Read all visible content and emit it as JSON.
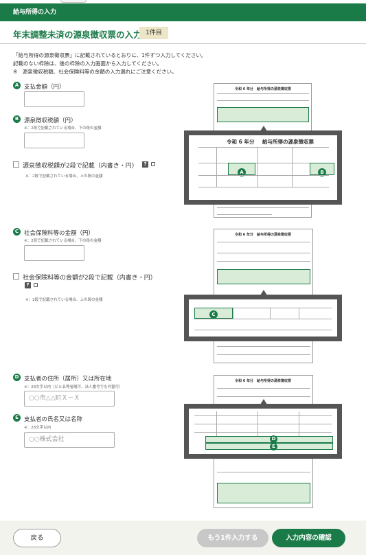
{
  "header": {
    "section": "給与所得の入力"
  },
  "title": {
    "text": "年末調整未済の源泉徴収票の入力",
    "badge": "1件目"
  },
  "instructions": [
    "「給与所得の源泉徴収票」に記載されているとおりに、1件ずつ入力してください。",
    "記載のない枠除は、後の枠除の入力画面から入力してください。",
    "※　源泉徴収税額、社会保険料等の金額の入力漏れにご注意ください。"
  ],
  "fields": {
    "a": {
      "marker": "A",
      "label": "支払金額（円）",
      "value": ""
    },
    "b": {
      "marker": "B",
      "label": "源泉徴収税額（円）",
      "note": "※：2段で記載されている場合、下の段の金額",
      "value": ""
    },
    "b_check": {
      "label": "源泉徴収税額が2段で記載（内書き・円）",
      "note": "※：2段で記載されている場合、上の段の金額",
      "help": "?"
    },
    "c": {
      "marker": "C",
      "label": "社会保険料等の金額（円）",
      "note": "※：2段で記載されている場合、下の段の金額",
      "value": ""
    },
    "c_check": {
      "label": "社会保険料等の金額が2段で記載（内書き・円）",
      "note": "※：2段で記載されている場合、上の段の金額",
      "help": "?"
    },
    "d": {
      "marker": "D",
      "label": "支払者の住所（居所）又は所在地",
      "note": "※：28文字以内（ビル名等省略可、法人番号でも代替可）",
      "placeholder": "○○市△△町Ｘ－Ｘ"
    },
    "e": {
      "marker": "E",
      "label": "支払者の氏名又は名称",
      "note": "※：28文字以内",
      "placeholder": "○○株式会社"
    }
  },
  "illustrations": {
    "doc_title": "令和 6 年分　給与所得の源泉徴収票",
    "zoom_title_era": "令和 6 年分",
    "zoom_title": "給与所得の源泉徴収票",
    "markers": [
      "A",
      "B",
      "C",
      "D",
      "E"
    ]
  },
  "footer": {
    "back": "戻る",
    "add_more": "もう1件入力する",
    "confirm": "入力内容の確認"
  },
  "colors": {
    "brand": "#1a7a48",
    "badge_bg": "#ece6c6",
    "disabled": "#c8c8c8"
  }
}
